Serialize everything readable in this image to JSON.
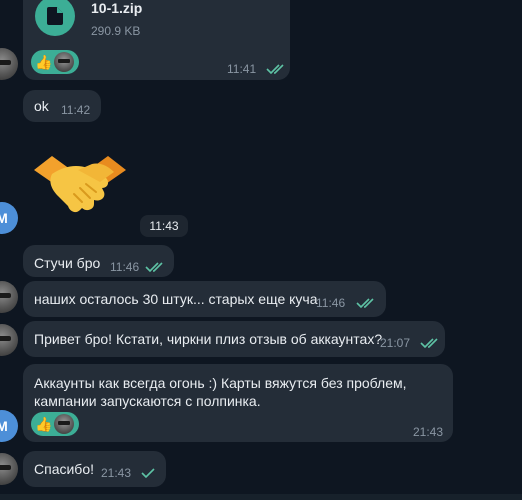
{
  "file_message": {
    "file_name": "10-1.zip",
    "file_size": "290.9 KB",
    "time": "11:41",
    "reaction_emoji": "👍"
  },
  "messages": [
    {
      "text": "ok",
      "time": "11:42"
    },
    {
      "sticker": "handshake",
      "time": "11:43"
    },
    {
      "text": "Стучи бро",
      "time": "11:46"
    },
    {
      "text": "наших осталось 30 штук... старых еще куча",
      "time": "11:46"
    },
    {
      "text": "Привет бро! Кстати, чиркни плиз отзыв об аккаунтах?",
      "time": "21:07"
    },
    {
      "text_lines": [
        "Аккаунты как всегда огонь :) Карты вяжутся без проблем,",
        "кампании запускаются с полпинка."
      ],
      "time": "21:43",
      "reaction_emoji": "👍"
    },
    {
      "text": "Спасибо!",
      "time": "21:43"
    }
  ],
  "avatars": {
    "letter": "M"
  },
  "colors": {
    "background": "#0e1621",
    "bubble": "#242d38",
    "accent": "#3cae96",
    "read_ticks": "#5ec3a5",
    "avatar_letter_bg": "#4d8fd8"
  },
  "icons": {
    "file": "file-icon",
    "read_status": "double-check-icon",
    "sent_status": "single-check-icon",
    "sticker": "handshake-icon"
  }
}
